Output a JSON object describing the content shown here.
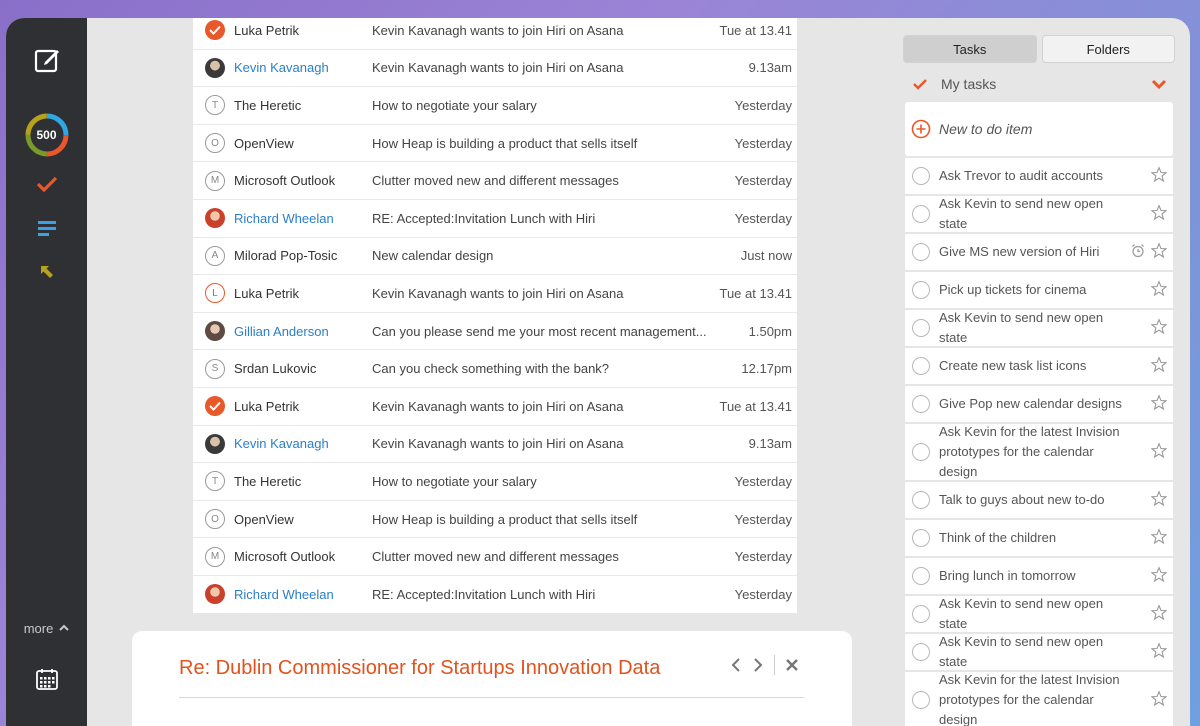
{
  "sidebar": {
    "badge": "500",
    "more_label": "more"
  },
  "mails": [
    {
      "sender": "Luka Petrik",
      "subject": "Kevin Kavanagh wants to join Hiri on Asana",
      "time": "Tue at 13.41",
      "avatar": "check",
      "blue": false
    },
    {
      "sender": "Kevin Kavanagh",
      "subject": "Kevin Kavanagh wants to join Hiri on Asana",
      "time": "9.13am",
      "avatar": "photo1",
      "blue": true
    },
    {
      "sender": "The Heretic",
      "subject": "How to negotiate your salary",
      "time": "Yesterday",
      "avatar": "letter",
      "letter": "T",
      "blue": false
    },
    {
      "sender": "OpenView",
      "subject": "How Heap is building a product that sells itself",
      "time": "Yesterday",
      "avatar": "letter",
      "letter": "O",
      "blue": false
    },
    {
      "sender": "Microsoft Outlook",
      "subject": "Clutter moved new and different messages",
      "time": "Yesterday",
      "avatar": "letter",
      "letter": "M",
      "blue": false
    },
    {
      "sender": "Richard Wheelan",
      "subject": "RE: Accepted:Invitation Lunch with Hiri",
      "time": "Yesterday",
      "avatar": "photo2",
      "blue": true
    },
    {
      "sender": "Milorad Pop-Tosic",
      "subject": "New calendar design",
      "time": "Just now",
      "avatar": "letter",
      "letter": "A",
      "blue": false
    },
    {
      "sender": "Luka Petrik",
      "subject": "Kevin Kavanagh wants to join Hiri on Asana",
      "time": "Tue at 13.41",
      "avatar": "letter-orange",
      "letter": "L",
      "blue": false
    },
    {
      "sender": "Gillian Anderson",
      "subject": "Can you please send me your most recent management...",
      "time": "1.50pm",
      "avatar": "photo3",
      "blue": true
    },
    {
      "sender": "Srdan Lukovic",
      "subject": "Can you check something with the bank?",
      "time": "12.17pm",
      "avatar": "letter",
      "letter": "S",
      "blue": false
    },
    {
      "sender": "Luka Petrik",
      "subject": "Kevin Kavanagh wants to join Hiri on Asana",
      "time": "Tue at 13.41",
      "avatar": "check",
      "blue": false
    },
    {
      "sender": "Kevin Kavanagh",
      "subject": "Kevin Kavanagh wants to join Hiri on Asana",
      "time": "9.13am",
      "avatar": "photo1",
      "blue": true
    },
    {
      "sender": "The Heretic",
      "subject": "How to negotiate your salary",
      "time": "Yesterday",
      "avatar": "letter",
      "letter": "T",
      "blue": false
    },
    {
      "sender": "OpenView",
      "subject": "How Heap is building a product that sells itself",
      "time": "Yesterday",
      "avatar": "letter",
      "letter": "O",
      "blue": false
    },
    {
      "sender": "Microsoft Outlook",
      "subject": "Clutter moved new and different messages",
      "time": "Yesterday",
      "avatar": "letter",
      "letter": "M",
      "blue": false
    },
    {
      "sender": "Richard Wheelan",
      "subject": "RE: Accepted:Invitation Lunch with Hiri",
      "time": "Yesterday",
      "avatar": "photo2",
      "blue": true
    }
  ],
  "reading": {
    "title": "Re: Dublin Commissioner for Startups Innovation Data"
  },
  "tasks_panel": {
    "tab_tasks": "Tasks",
    "tab_folders": "Folders",
    "list_name": "My tasks",
    "new_item": "New to do item",
    "items": [
      {
        "label": "Ask Trevor to audit accounts",
        "alarm": false,
        "lines": 1
      },
      {
        "label": "Ask Kevin to send new open state",
        "alarm": false,
        "lines": 1
      },
      {
        "label": "Give MS new version of Hiri",
        "alarm": true,
        "lines": 1
      },
      {
        "label": "Pick up tickets for cinema",
        "alarm": false,
        "lines": 1
      },
      {
        "label": "Ask Kevin to send new open state",
        "alarm": false,
        "lines": 1
      },
      {
        "label": "Create new task list icons",
        "alarm": false,
        "lines": 1
      },
      {
        "label": "Give Pop new calendar designs",
        "alarm": false,
        "lines": 1
      },
      {
        "label": "Ask Kevin for the latest Invision prototypes for the calendar design",
        "alarm": false,
        "lines": 2
      },
      {
        "label": "Talk to guys about new to-do",
        "alarm": false,
        "lines": 1
      },
      {
        "label": "Think of the children",
        "alarm": false,
        "lines": 1
      },
      {
        "label": "Bring lunch in tomorrow",
        "alarm": false,
        "lines": 1
      },
      {
        "label": "Ask Kevin to send new open state",
        "alarm": false,
        "lines": 1
      },
      {
        "label": "Ask Kevin to send new open state",
        "alarm": false,
        "lines": 1
      },
      {
        "label": "Ask Kevin for the latest Invision prototypes for the calendar design",
        "alarm": false,
        "lines": 2
      }
    ]
  },
  "colors": {
    "accent": "#e8582a",
    "link": "#2a7fc9",
    "sidebar": "#2f3033"
  }
}
